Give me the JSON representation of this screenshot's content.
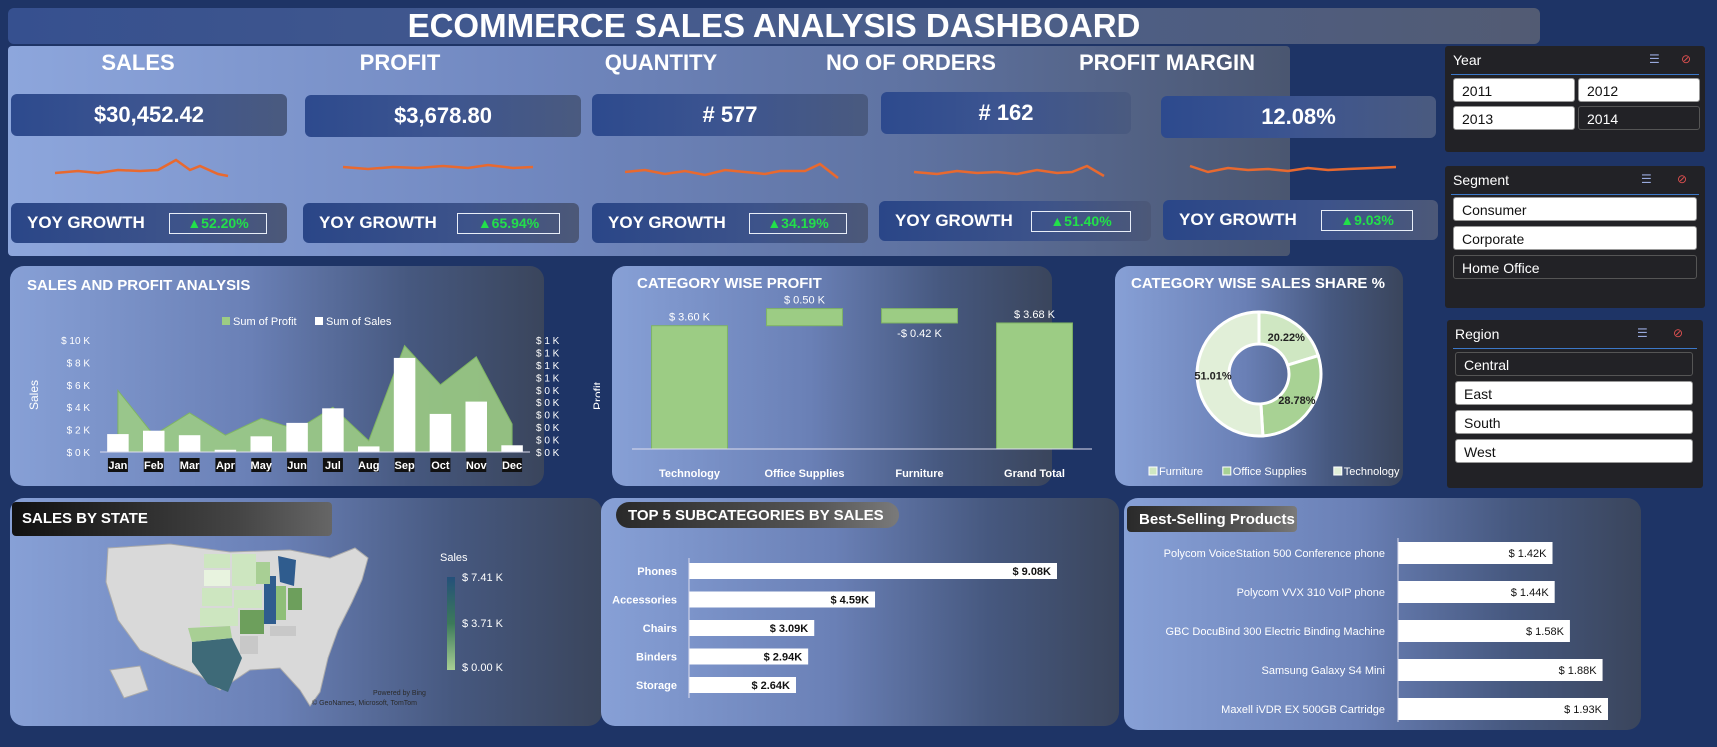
{
  "title": "ECOMMERCE SALES ANALYSIS DASHBOARD",
  "kpis": [
    {
      "head": "SALES",
      "value": "$30,452.42",
      "yoy_label": "YOY GROWTH",
      "yoy": "▲52.20%"
    },
    {
      "head": "PROFIT",
      "value": "$3,678.80",
      "yoy_label": "YOY GROWTH",
      "yoy": "▲65.94%"
    },
    {
      "head": "QUANTITY",
      "value": "# 577",
      "yoy_label": "YOY GROWTH",
      "yoy": "▲34.19%"
    },
    {
      "head": "NO OF ORDERS",
      "value": "# 162",
      "yoy_label": "YOY GROWTH",
      "yoy": "▲51.40%"
    },
    {
      "head": "PROFIT MARGIN",
      "value": "12.08%",
      "yoy_label": "YOY GROWTH",
      "yoy": "▲9.03%"
    }
  ],
  "colors": {
    "spark": "#e8692f",
    "bar_green": "#9ccc84",
    "positive": "#22e04a",
    "accent_line": "#3c78c8"
  },
  "panels": {
    "sales_profit": "SALES AND PROFIT ANALYSIS",
    "category_profit": "CATEGORY WISE PROFIT",
    "category_share": "CATEGORY WISE SALES SHARE %",
    "sales_by_state": "SALES BY STATE",
    "top5": "TOP 5 SUBCATEGORIES BY SALES",
    "best_selling": "Best-Selling Products"
  },
  "map": {
    "legend_title": "Sales",
    "legend_max": "$ 7.41 K",
    "legend_mid": "$ 3.71 K",
    "legend_min": "$ 0.00 K",
    "credit1": "Powered by Bing",
    "credit2": "© GeoNames, Microsoft, TomTom"
  },
  "slicers": {
    "year": {
      "title": "Year",
      "items": [
        "2011",
        "2012",
        "2013",
        "2014"
      ]
    },
    "segment": {
      "title": "Segment",
      "items": [
        "Consumer",
        "Corporate",
        "Home Office"
      ]
    },
    "region": {
      "title": "Region",
      "items": [
        "Central",
        "East",
        "South",
        "West"
      ]
    }
  },
  "chart_data": [
    {
      "type": "bar",
      "title": "SALES AND PROFIT ANALYSIS",
      "categories": [
        "Jan",
        "Feb",
        "Mar",
        "Apr",
        "May",
        "Jun",
        "Jul",
        "Aug",
        "Sep",
        "Oct",
        "Nov",
        "Dec"
      ],
      "series": [
        {
          "name": "Sum of Sales",
          "type": "bar",
          "axis": "left",
          "values": [
            1.6,
            1.9,
            1.5,
            0.2,
            1.4,
            2.6,
            3.9,
            0.5,
            8.4,
            3.4,
            4.5,
            0.6
          ]
        },
        {
          "name": "Sum of Profit",
          "type": "area",
          "axis": "right",
          "values": [
            0.55,
            0.15,
            0.35,
            0.15,
            0.3,
            0.2,
            0.4,
            0.1,
            0.95,
            0.6,
            0.85,
            0.25
          ]
        }
      ],
      "ylabel": "Sales",
      "y2label": "Profit",
      "y_ticks": [
        "$ 0 K",
        "$ 2 K",
        "$ 4 K",
        "$ 6 K",
        "$ 8 K",
        "$ 10 K"
      ],
      "y2_ticks": [
        "$ 0 K",
        "$ 0 K",
        "$ 0 K",
        "$ 0 K",
        "$ 0 K",
        "$ 0 K",
        "$ 1 K",
        "$ 1 K",
        "$ 1 K",
        "$ 1 K"
      ],
      "ylim": [
        0,
        10
      ],
      "y2lim": [
        0,
        1
      ],
      "legend": "top"
    },
    {
      "type": "bar",
      "subtype": "waterfall",
      "title": "CATEGORY WISE PROFIT",
      "categories": [
        "Technology",
        "Office Supplies",
        "Furniture",
        "Grand Total"
      ],
      "values": [
        3.6,
        0.5,
        -0.42,
        3.68
      ],
      "labels": [
        "$ 3.60 K",
        "$ 0.50 K",
        "-$ 0.42 K",
        "$ 3.68 K"
      ],
      "ylim": [
        0,
        4.0
      ]
    },
    {
      "type": "pie",
      "subtype": "donut",
      "title": "CATEGORY WISE SALES SHARE %",
      "categories": [
        "Furniture",
        "Office Supplies",
        "Technology"
      ],
      "values": [
        20.22,
        28.78,
        51.01
      ],
      "labels": [
        "20.22%",
        "28.78%",
        "51.01%"
      ],
      "legend": "bottom"
    },
    {
      "type": "bar",
      "orientation": "horizontal",
      "title": "TOP 5 SUBCATEGORIES BY SALES",
      "categories": [
        "Phones",
        "Accessories",
        "Chairs",
        "Binders",
        "Storage"
      ],
      "values": [
        9.08,
        4.59,
        3.09,
        2.94,
        2.64
      ],
      "labels": [
        "$ 9.08K",
        "$ 4.59K",
        "$ 3.09K",
        "$ 2.94K",
        "$ 2.64K"
      ]
    },
    {
      "type": "bar",
      "orientation": "horizontal",
      "title": "Best-Selling Products",
      "categories": [
        "Polycom VoiceStation 500 Conference phone",
        "Polycom VVX 310 VoIP phone",
        "GBC DocuBind 300 Electric Binding Machine",
        "Samsung Galaxy S4 Mini",
        "Maxell iVDR EX 500GB Cartridge"
      ],
      "values": [
        1.42,
        1.44,
        1.58,
        1.88,
        1.93
      ],
      "labels": [
        "$ 1.42K",
        "$ 1.44K",
        "$ 1.58K",
        "$ 1.88K",
        "$ 1.93K"
      ]
    }
  ]
}
